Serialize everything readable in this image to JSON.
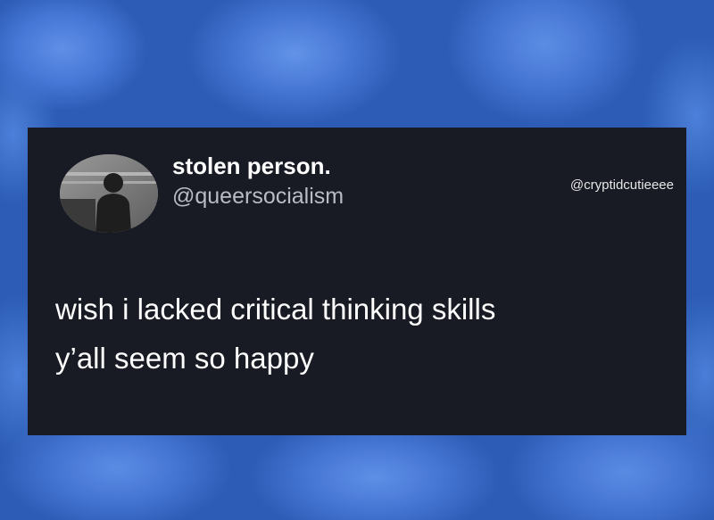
{
  "colors": {
    "card_background": "#181a24",
    "text_primary": "#ffffff",
    "text_secondary": "#b8bcc4",
    "background_blue": "#3a6bc8"
  },
  "tweet": {
    "display_name": "stolen person.",
    "handle": "@queersocialism",
    "lines": [
      "wish i lacked critical thinking skills",
      "y’all seem so happy"
    ]
  },
  "watermark": "@cryptidcutieeee"
}
